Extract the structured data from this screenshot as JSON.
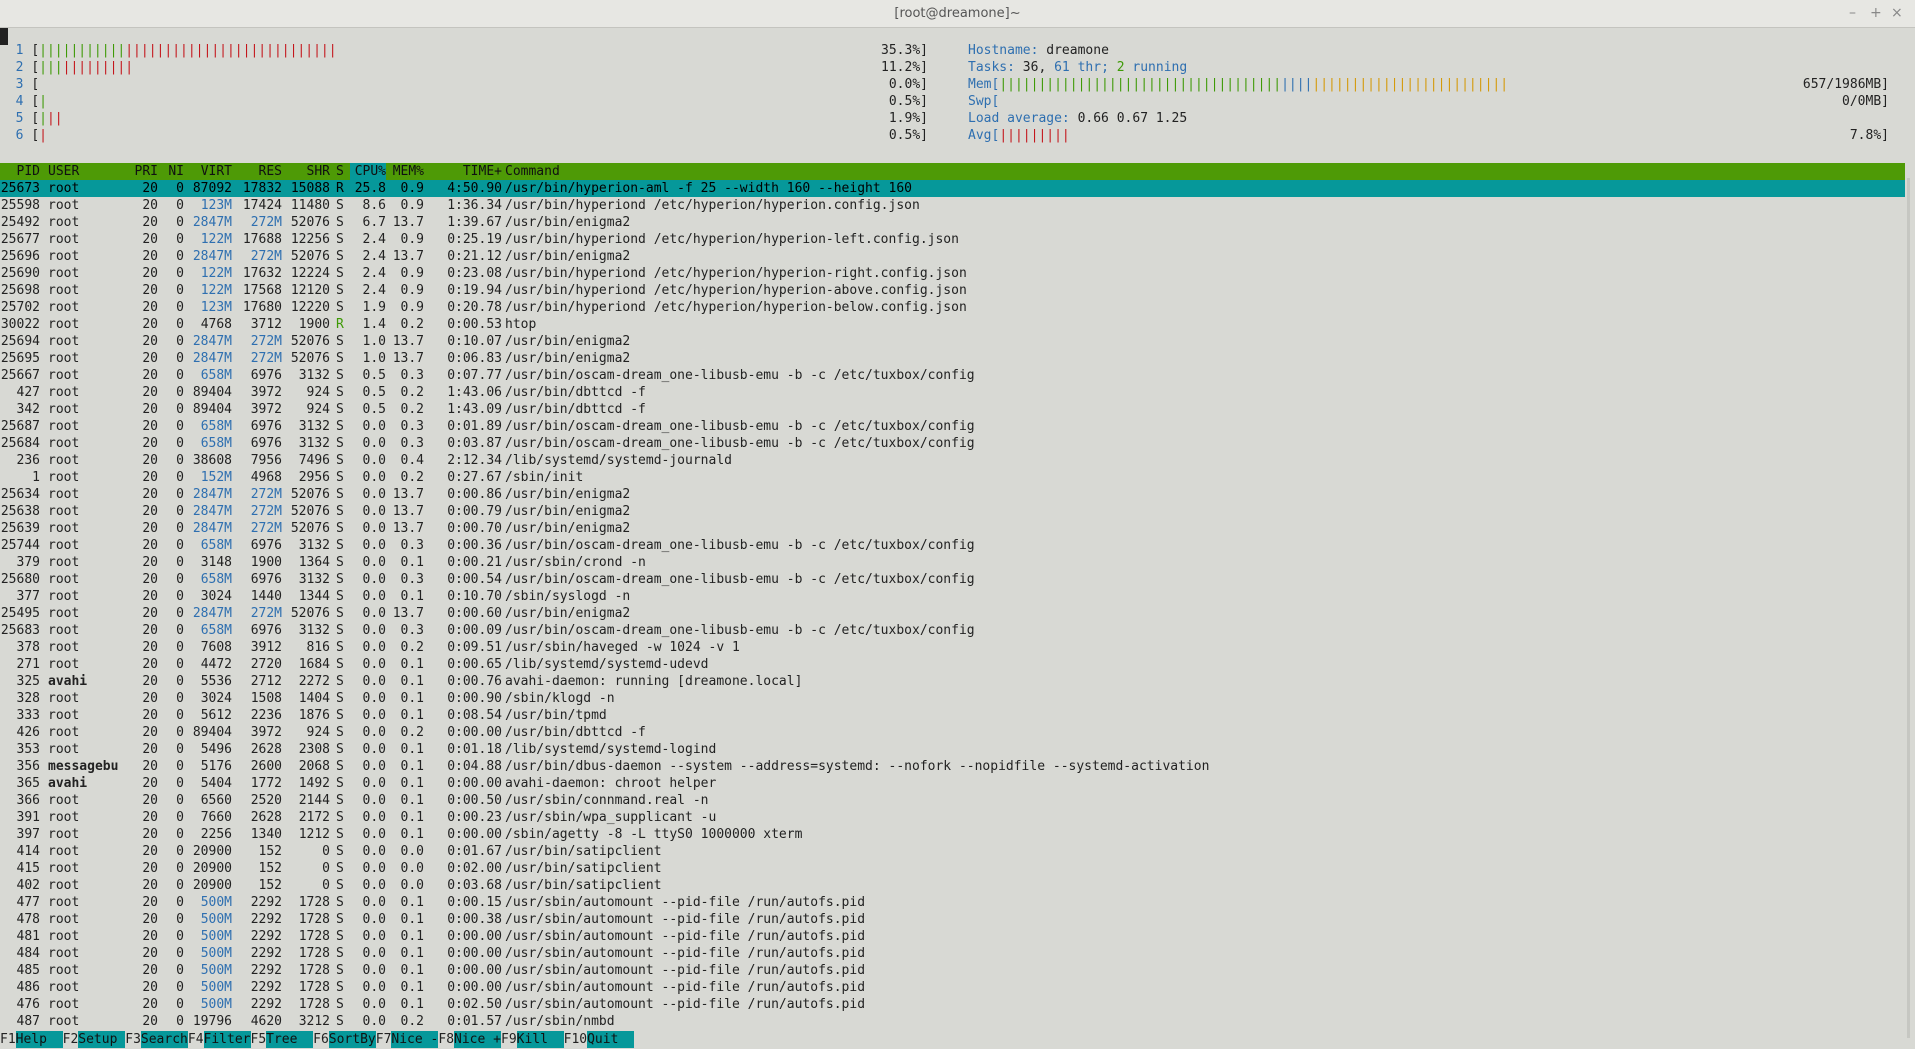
{
  "window": {
    "title": "[root@dreamone]~",
    "controls": [
      "–",
      "+",
      "×"
    ]
  },
  "cpus": [
    {
      "n": "1",
      "green": 11,
      "red": 27,
      "value": "35.3%]"
    },
    {
      "n": "2",
      "green": 3,
      "red": 9,
      "value": "11.2%]"
    },
    {
      "n": "3",
      "green": 0,
      "red": 0,
      "value": "0.0%]"
    },
    {
      "n": "4",
      "green": 1,
      "red": 0,
      "value": "0.5%]"
    },
    {
      "n": "5",
      "green": 1,
      "red": 2,
      "value": "1.9%]"
    },
    {
      "n": "6",
      "green": 0,
      "red": 1,
      "value": "0.5%]"
    }
  ],
  "sysinfo": {
    "hostname_label": "Hostname: ",
    "hostname": "dreamone",
    "tasks_label": "Tasks: ",
    "tasks_count": "36,",
    "tasks_thr": "61",
    "tasks_thr_label": "thr;",
    "tasks_running": "2",
    "tasks_running_label": "running",
    "mem_label": "Mem[",
    "mem_green": 36,
    "mem_cyan": 4,
    "mem_orange": 25,
    "mem_value": "657/1986MB]",
    "swp_label": "Swp[",
    "swp_value": "0/0MB]",
    "load_label": "Load average: ",
    "load_values": "0.66 0.67 1.25",
    "avg_label": "Avg[",
    "avg_red": 9,
    "avg_value": "7.8%]"
  },
  "columns": [
    "PID",
    "USER",
    "PRI",
    "NI",
    "VIRT",
    "RES",
    "SHR",
    "S",
    "CPU%",
    "MEM%",
    "TIME+",
    "Command"
  ],
  "processes": [
    [
      "25673",
      "root",
      "20",
      "0",
      "87092",
      "17832",
      "15088",
      "R",
      "25.8",
      "0.9",
      "4:50.90",
      "/usr/bin/hyperion-aml -f 25 --width 160 --height 160"
    ],
    [
      "25598",
      "root",
      "20",
      "0",
      "123M",
      "17424",
      "11480",
      "S",
      "8.6",
      "0.9",
      "1:36.34",
      "/usr/bin/hyperiond /etc/hyperion/hyperion.config.json"
    ],
    [
      "25492",
      "root",
      "20",
      "0",
      "2847M",
      "272M",
      "52076",
      "S",
      "6.7",
      "13.7",
      "1:39.67",
      "/usr/bin/enigma2"
    ],
    [
      "25677",
      "root",
      "20",
      "0",
      "122M",
      "17688",
      "12256",
      "S",
      "2.4",
      "0.9",
      "0:25.19",
      "/usr/bin/hyperiond /etc/hyperion/hyperion-left.config.json"
    ],
    [
      "25696",
      "root",
      "20",
      "0",
      "2847M",
      "272M",
      "52076",
      "S",
      "2.4",
      "13.7",
      "0:21.12",
      "/usr/bin/enigma2"
    ],
    [
      "25690",
      "root",
      "20",
      "0",
      "122M",
      "17632",
      "12224",
      "S",
      "2.4",
      "0.9",
      "0:23.08",
      "/usr/bin/hyperiond /etc/hyperion/hyperion-right.config.json"
    ],
    [
      "25698",
      "root",
      "20",
      "0",
      "122M",
      "17568",
      "12120",
      "S",
      "2.4",
      "0.9",
      "0:19.94",
      "/usr/bin/hyperiond /etc/hyperion/hyperion-above.config.json"
    ],
    [
      "25702",
      "root",
      "20",
      "0",
      "123M",
      "17680",
      "12220",
      "S",
      "1.9",
      "0.9",
      "0:20.78",
      "/usr/bin/hyperiond /etc/hyperion/hyperion-below.config.json"
    ],
    [
      "30022",
      "root",
      "20",
      "0",
      "4768",
      "3712",
      "1900",
      "R",
      "1.4",
      "0.2",
      "0:00.53",
      "htop"
    ],
    [
      "25694",
      "root",
      "20",
      "0",
      "2847M",
      "272M",
      "52076",
      "S",
      "1.0",
      "13.7",
      "0:10.07",
      "/usr/bin/enigma2"
    ],
    [
      "25695",
      "root",
      "20",
      "0",
      "2847M",
      "272M",
      "52076",
      "S",
      "1.0",
      "13.7",
      "0:06.83",
      "/usr/bin/enigma2"
    ],
    [
      "25667",
      "root",
      "20",
      "0",
      "658M",
      "6976",
      "3132",
      "S",
      "0.5",
      "0.3",
      "0:07.77",
      "/usr/bin/oscam-dream_one-libusb-emu -b -c /etc/tuxbox/config"
    ],
    [
      "427",
      "root",
      "20",
      "0",
      "89404",
      "3972",
      "924",
      "S",
      "0.5",
      "0.2",
      "1:43.06",
      "/usr/bin/dbttcd -f"
    ],
    [
      "342",
      "root",
      "20",
      "0",
      "89404",
      "3972",
      "924",
      "S",
      "0.5",
      "0.2",
      "1:43.09",
      "/usr/bin/dbttcd -f"
    ],
    [
      "25687",
      "root",
      "20",
      "0",
      "658M",
      "6976",
      "3132",
      "S",
      "0.0",
      "0.3",
      "0:01.89",
      "/usr/bin/oscam-dream_one-libusb-emu -b -c /etc/tuxbox/config"
    ],
    [
      "25684",
      "root",
      "20",
      "0",
      "658M",
      "6976",
      "3132",
      "S",
      "0.0",
      "0.3",
      "0:03.87",
      "/usr/bin/oscam-dream_one-libusb-emu -b -c /etc/tuxbox/config"
    ],
    [
      "236",
      "root",
      "20",
      "0",
      "38608",
      "7956",
      "7496",
      "S",
      "0.0",
      "0.4",
      "2:12.34",
      "/lib/systemd/systemd-journald"
    ],
    [
      "1",
      "root",
      "20",
      "0",
      "152M",
      "4968",
      "2956",
      "S",
      "0.0",
      "0.2",
      "0:27.67",
      "/sbin/init"
    ],
    [
      "25634",
      "root",
      "20",
      "0",
      "2847M",
      "272M",
      "52076",
      "S",
      "0.0",
      "13.7",
      "0:00.86",
      "/usr/bin/enigma2"
    ],
    [
      "25638",
      "root",
      "20",
      "0",
      "2847M",
      "272M",
      "52076",
      "S",
      "0.0",
      "13.7",
      "0:00.79",
      "/usr/bin/enigma2"
    ],
    [
      "25639",
      "root",
      "20",
      "0",
      "2847M",
      "272M",
      "52076",
      "S",
      "0.0",
      "13.7",
      "0:00.70",
      "/usr/bin/enigma2"
    ],
    [
      "25744",
      "root",
      "20",
      "0",
      "658M",
      "6976",
      "3132",
      "S",
      "0.0",
      "0.3",
      "0:00.36",
      "/usr/bin/oscam-dream_one-libusb-emu -b -c /etc/tuxbox/config"
    ],
    [
      "379",
      "root",
      "20",
      "0",
      "3148",
      "1900",
      "1364",
      "S",
      "0.0",
      "0.1",
      "0:00.21",
      "/usr/sbin/crond -n"
    ],
    [
      "25680",
      "root",
      "20",
      "0",
      "658M",
      "6976",
      "3132",
      "S",
      "0.0",
      "0.3",
      "0:00.54",
      "/usr/bin/oscam-dream_one-libusb-emu -b -c /etc/tuxbox/config"
    ],
    [
      "377",
      "root",
      "20",
      "0",
      "3024",
      "1440",
      "1344",
      "S",
      "0.0",
      "0.1",
      "0:10.70",
      "/sbin/syslogd -n"
    ],
    [
      "25495",
      "root",
      "20",
      "0",
      "2847M",
      "272M",
      "52076",
      "S",
      "0.0",
      "13.7",
      "0:00.60",
      "/usr/bin/enigma2"
    ],
    [
      "25683",
      "root",
      "20",
      "0",
      "658M",
      "6976",
      "3132",
      "S",
      "0.0",
      "0.3",
      "0:00.09",
      "/usr/bin/oscam-dream_one-libusb-emu -b -c /etc/tuxbox/config"
    ],
    [
      "378",
      "root",
      "20",
      "0",
      "7608",
      "3912",
      "816",
      "S",
      "0.0",
      "0.2",
      "0:09.51",
      "/usr/sbin/haveged -w 1024 -v 1"
    ],
    [
      "271",
      "root",
      "20",
      "0",
      "4472",
      "2720",
      "1684",
      "S",
      "0.0",
      "0.1",
      "0:00.65",
      "/lib/systemd/systemd-udevd"
    ],
    [
      "325",
      "avahi",
      "20",
      "0",
      "5536",
      "2712",
      "2272",
      "S",
      "0.0",
      "0.1",
      "0:00.76",
      "avahi-daemon: running [dreamone.local]"
    ],
    [
      "328",
      "root",
      "20",
      "0",
      "3024",
      "1508",
      "1404",
      "S",
      "0.0",
      "0.1",
      "0:00.90",
      "/sbin/klogd -n"
    ],
    [
      "333",
      "root",
      "20",
      "0",
      "5612",
      "2236",
      "1876",
      "S",
      "0.0",
      "0.1",
      "0:08.54",
      "/usr/bin/tpmd"
    ],
    [
      "426",
      "root",
      "20",
      "0",
      "89404",
      "3972",
      "924",
      "S",
      "0.0",
      "0.2",
      "0:00.00",
      "/usr/bin/dbttcd -f"
    ],
    [
      "353",
      "root",
      "20",
      "0",
      "5496",
      "2628",
      "2308",
      "S",
      "0.0",
      "0.1",
      "0:01.18",
      "/lib/systemd/systemd-logind"
    ],
    [
      "356",
      "messagebu",
      "20",
      "0",
      "5176",
      "2600",
      "2068",
      "S",
      "0.0",
      "0.1",
      "0:04.88",
      "/usr/bin/dbus-daemon --system --address=systemd: --nofork --nopidfile --systemd-activation"
    ],
    [
      "365",
      "avahi",
      "20",
      "0",
      "5404",
      "1772",
      "1492",
      "S",
      "0.0",
      "0.1",
      "0:00.00",
      "avahi-daemon: chroot helper"
    ],
    [
      "366",
      "root",
      "20",
      "0",
      "6560",
      "2520",
      "2144",
      "S",
      "0.0",
      "0.1",
      "0:00.50",
      "/usr/sbin/connmand.real -n"
    ],
    [
      "391",
      "root",
      "20",
      "0",
      "7660",
      "2628",
      "2172",
      "S",
      "0.0",
      "0.1",
      "0:00.23",
      "/usr/sbin/wpa_supplicant -u"
    ],
    [
      "397",
      "root",
      "20",
      "0",
      "2256",
      "1340",
      "1212",
      "S",
      "0.0",
      "0.1",
      "0:00.00",
      "/sbin/agetty -8 -L ttyS0 1000000 xterm"
    ],
    [
      "414",
      "root",
      "20",
      "0",
      "20900",
      "152",
      "0",
      "S",
      "0.0",
      "0.0",
      "0:01.67",
      "/usr/bin/satipclient"
    ],
    [
      "415",
      "root",
      "20",
      "0",
      "20900",
      "152",
      "0",
      "S",
      "0.0",
      "0.0",
      "0:02.00",
      "/usr/bin/satipclient"
    ],
    [
      "402",
      "root",
      "20",
      "0",
      "20900",
      "152",
      "0",
      "S",
      "0.0",
      "0.0",
      "0:03.68",
      "/usr/bin/satipclient"
    ],
    [
      "477",
      "root",
      "20",
      "0",
      "500M",
      "2292",
      "1728",
      "S",
      "0.0",
      "0.1",
      "0:00.15",
      "/usr/sbin/automount --pid-file /run/autofs.pid"
    ],
    [
      "478",
      "root",
      "20",
      "0",
      "500M",
      "2292",
      "1728",
      "S",
      "0.0",
      "0.1",
      "0:00.38",
      "/usr/sbin/automount --pid-file /run/autofs.pid"
    ],
    [
      "481",
      "root",
      "20",
      "0",
      "500M",
      "2292",
      "1728",
      "S",
      "0.0",
      "0.1",
      "0:00.00",
      "/usr/sbin/automount --pid-file /run/autofs.pid"
    ],
    [
      "484",
      "root",
      "20",
      "0",
      "500M",
      "2292",
      "1728",
      "S",
      "0.0",
      "0.1",
      "0:00.00",
      "/usr/sbin/automount --pid-file /run/autofs.pid"
    ],
    [
      "485",
      "root",
      "20",
      "0",
      "500M",
      "2292",
      "1728",
      "S",
      "0.0",
      "0.1",
      "0:00.00",
      "/usr/sbin/automount --pid-file /run/autofs.pid"
    ],
    [
      "486",
      "root",
      "20",
      "0",
      "500M",
      "2292",
      "1728",
      "S",
      "0.0",
      "0.1",
      "0:00.00",
      "/usr/sbin/automount --pid-file /run/autofs.pid"
    ],
    [
      "476",
      "root",
      "20",
      "0",
      "500M",
      "2292",
      "1728",
      "S",
      "0.0",
      "0.1",
      "0:02.50",
      "/usr/sbin/automount --pid-file /run/autofs.pid"
    ],
    [
      "487",
      "root",
      "20",
      "0",
      "19796",
      "4620",
      "3212",
      "S",
      "0.0",
      "0.2",
      "0:01.57",
      "/usr/sbin/nmbd"
    ]
  ],
  "footer": [
    {
      "key": "F1",
      "label": "Help  "
    },
    {
      "key": "F2",
      "label": "Setup "
    },
    {
      "key": "F3",
      "label": "Search"
    },
    {
      "key": "F4",
      "label": "Filter"
    },
    {
      "key": "F5",
      "label": "Tree  "
    },
    {
      "key": "F6",
      "label": "SortBy"
    },
    {
      "key": "F7",
      "label": "Nice -"
    },
    {
      "key": "F8",
      "label": "Nice +"
    },
    {
      "key": "F9",
      "label": "Kill  "
    },
    {
      "key": "F10",
      "label": "Quit  "
    }
  ],
  "colors": {
    "header_bg": "#4e9a06",
    "selected_bg": "#06989a",
    "cyan_text": "#2e6fb0",
    "green_bar": "#3e9a06",
    "red_bar": "#c4161c",
    "orange_bar": "#d49a0a"
  }
}
